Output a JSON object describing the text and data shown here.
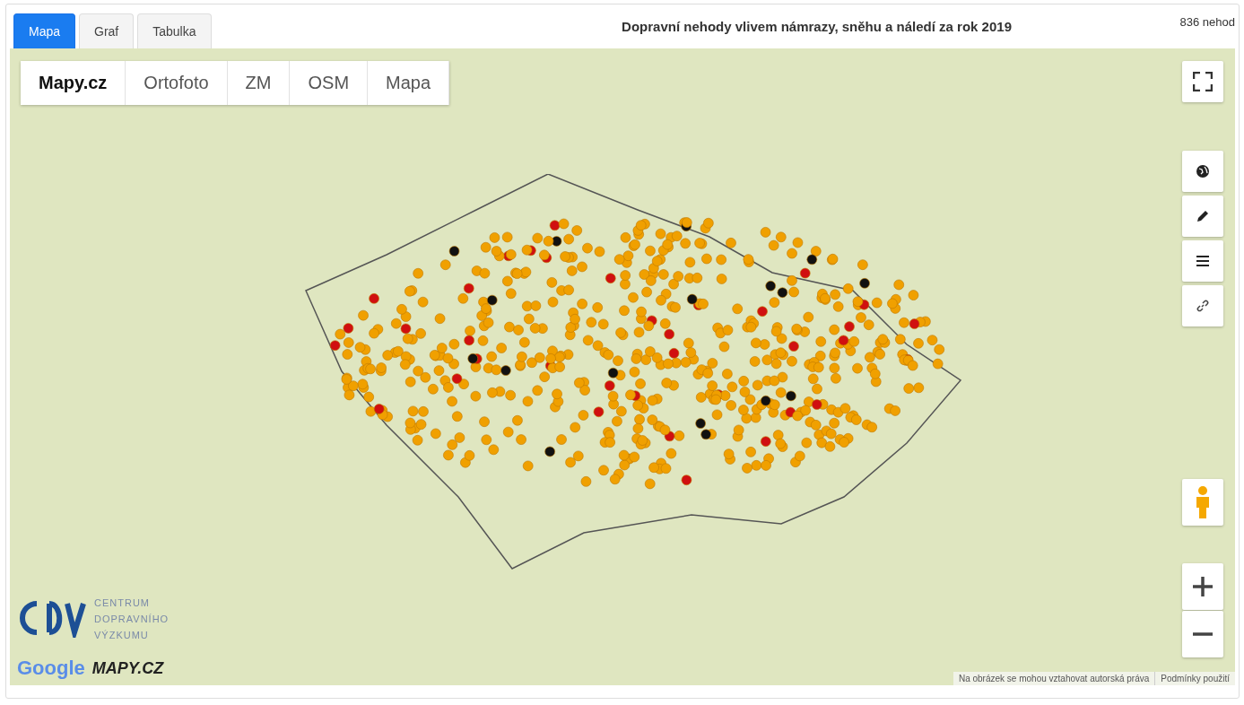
{
  "tabs": [
    {
      "label": "Mapa",
      "selected": true
    },
    {
      "label": "Graf",
      "selected": false
    },
    {
      "label": "Tabulka",
      "selected": false
    }
  ],
  "title": "Dopravní nehody vlivem námrazy, sněhu a náledí za rok 2019",
  "count": "836 nehod",
  "map_layers": [
    {
      "label": "Mapy.cz",
      "selected": true
    },
    {
      "label": "Ortofoto",
      "selected": false
    },
    {
      "label": "ZM",
      "selected": false
    },
    {
      "label": "OSM",
      "selected": false
    },
    {
      "label": "Mapa",
      "selected": false
    }
  ],
  "logo": {
    "lines": [
      "CENTRUM",
      "DOPRAVNÍHO",
      "VÝZKUMU"
    ]
  },
  "providers": [
    "Google",
    "MAPY.CZ"
  ],
  "attribution": [
    "Na obrázek se mohou vztahovat autorská práva",
    "Podmínky použití"
  ]
}
